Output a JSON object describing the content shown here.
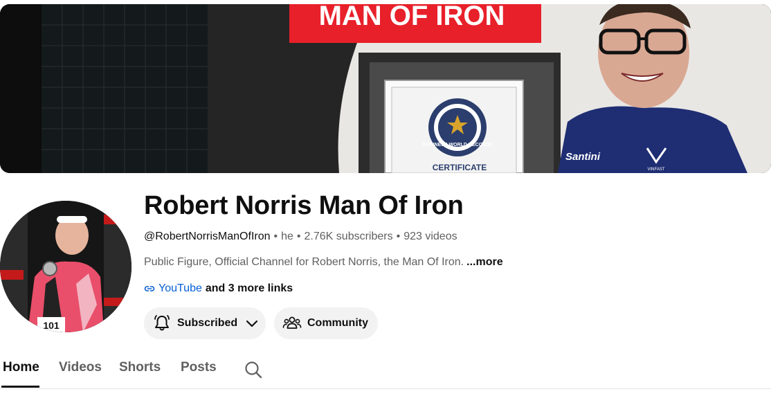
{
  "banner": {
    "title_text": "MAN OF IRON",
    "seal_text": "GUINNESS WORLD RECORDS",
    "certificate_label": "CERTIFICATE",
    "jersey_brand": "Santini",
    "jersey_sponsor": "VINFAST"
  },
  "avatar": {
    "bib_number": "101"
  },
  "channel": {
    "name": "Robert Norris Man Of Iron",
    "handle": "@RobertNorrisManOfIron",
    "pronouns": "he",
    "subscribers": "2.76K subscribers",
    "videos": "923 videos",
    "description": "Public Figure, Official Channel for Robert Norris, the Man Of Iron.",
    "more_label": "...more",
    "link_label": "YouTube",
    "more_links_label": "and 3 more links"
  },
  "buttons": {
    "subscribed_label": "Subscribed",
    "community_label": "Community"
  },
  "tabs": [
    {
      "label": "Home",
      "active": true
    },
    {
      "label": "Videos",
      "active": false
    },
    {
      "label": "Shorts",
      "active": false
    },
    {
      "label": "Posts",
      "active": false
    }
  ],
  "colors": {
    "link_blue": "#065fd4",
    "banner_red": "#e8202a",
    "button_bg": "#f2f2f2",
    "text_primary": "#0f0f0f",
    "text_secondary": "#606060"
  },
  "icons": {
    "link": "link-icon",
    "bell": "bell-icon",
    "chevron": "chevron-down-icon",
    "community": "people-icon",
    "search": "search-icon"
  }
}
